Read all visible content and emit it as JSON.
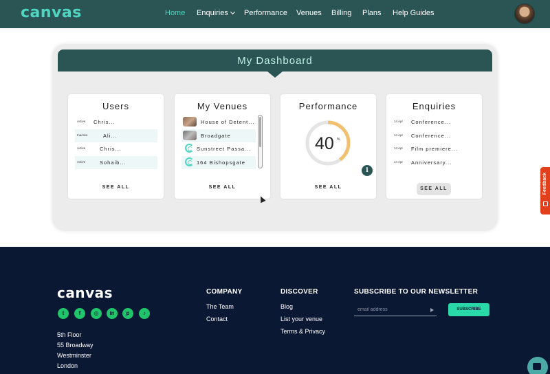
{
  "header": {
    "logo": "canvas",
    "nav": [
      {
        "label": "Home",
        "active": true
      },
      {
        "label": "Enquiries",
        "has_dropdown": true
      },
      {
        "label": "Performance"
      },
      {
        "label": "Venues"
      },
      {
        "label": "Billing"
      },
      {
        "label": "Plans"
      },
      {
        "label": "Help Guides"
      }
    ]
  },
  "dashboard": {
    "title": "My Dashboard",
    "users": {
      "title": "Users",
      "rows": [
        {
          "status": "Active",
          "name": "Chris..."
        },
        {
          "status": "Inactive",
          "name": "Ali..."
        },
        {
          "status": "Active",
          "name": "Chris..."
        },
        {
          "status": "Active",
          "name": "Sohaib..."
        }
      ],
      "see_all": "SEE ALL"
    },
    "venues": {
      "title": "My Venues",
      "rows": [
        {
          "name": "House of Detent...",
          "icon": "venue-photo-icon"
        },
        {
          "name": "Broadgate",
          "icon": "venue-photo-icon"
        },
        {
          "name": "Sunstreet Passa...",
          "icon": "canvas-c-icon"
        },
        {
          "name": "164 Bishopsgate",
          "icon": "canvas-c-icon"
        }
      ],
      "see_all": "SEE ALL"
    },
    "performance": {
      "title": "Performance",
      "value": "40",
      "unit": "%",
      "fraction": 0.4,
      "see_all": "SEE ALL",
      "info": "i"
    },
    "enquiries": {
      "title": "Enquiries",
      "rows": [
        {
          "date": "14 Apr",
          "name": "Conference..."
        },
        {
          "date": "14 Apr",
          "name": "Conference..."
        },
        {
          "date": "14 Apr",
          "name": "Film premiere..."
        },
        {
          "date": "14 Apr",
          "name": "Anniversary..."
        }
      ],
      "see_all": "SEE ALL"
    }
  },
  "feedback": {
    "label": "Feedback"
  },
  "footer": {
    "logo": "canvas",
    "social": [
      "twitter-icon",
      "facebook-icon",
      "instagram-icon",
      "linkedin-icon",
      "pinterest-icon",
      "tiktok-icon"
    ],
    "address": [
      "5th Floor",
      "55 Broadway",
      "Westminster",
      "London"
    ],
    "company": {
      "heading": "COMPANY",
      "links": [
        "The Team",
        "Contact"
      ]
    },
    "discover": {
      "heading": "DISCOVER",
      "links": [
        "Blog",
        "List your venue",
        "Terms & Privacy"
      ]
    },
    "newsletter": {
      "heading": "SUBSCRIBE TO OUR NEWSLETTER",
      "placeholder": "email address",
      "button": "SUBSCRIBE"
    }
  },
  "colors": {
    "brand_dark": "#2b5555",
    "accent": "#4fd5c0",
    "footer_bg": "#0b1833",
    "gauge": "#f0c070",
    "feedback": "#e2401c"
  }
}
